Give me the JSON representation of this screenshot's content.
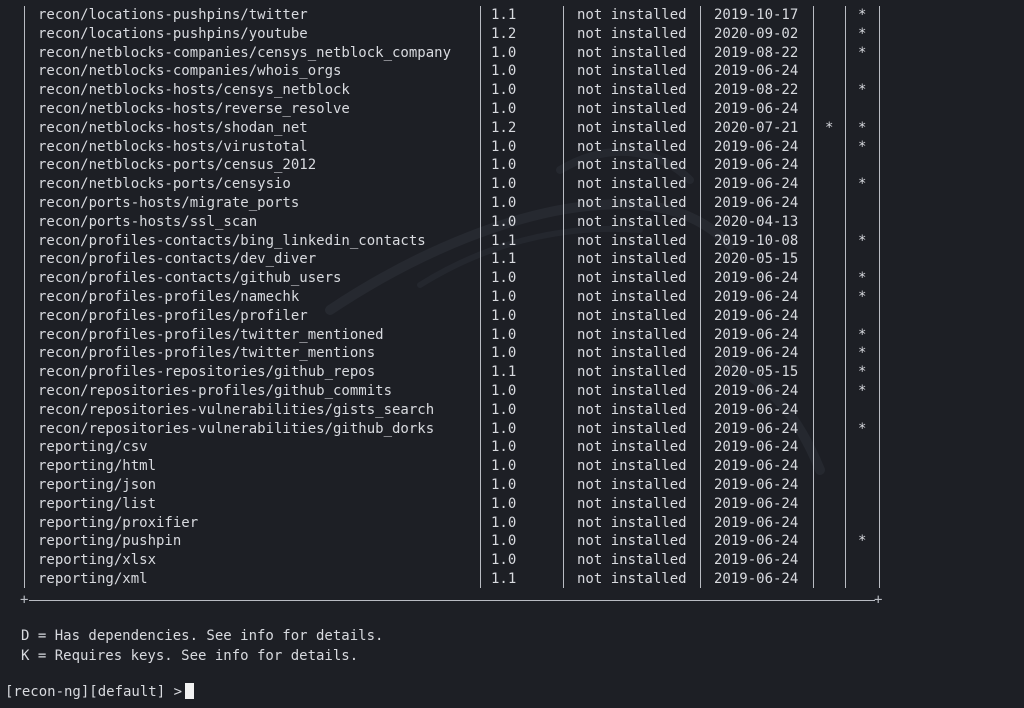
{
  "modules": [
    {
      "name": "recon/locations-pushpins/twitter",
      "version": "1.1",
      "status": "not installed",
      "updated": "2019-10-17",
      "d": "",
      "k": "*"
    },
    {
      "name": "recon/locations-pushpins/youtube",
      "version": "1.2",
      "status": "not installed",
      "updated": "2020-09-02",
      "d": "",
      "k": "*"
    },
    {
      "name": "recon/netblocks-companies/censys_netblock_company",
      "version": "1.0",
      "status": "not installed",
      "updated": "2019-08-22",
      "d": "",
      "k": "*"
    },
    {
      "name": "recon/netblocks-companies/whois_orgs",
      "version": "1.0",
      "status": "not installed",
      "updated": "2019-06-24",
      "d": "",
      "k": ""
    },
    {
      "name": "recon/netblocks-hosts/censys_netblock",
      "version": "1.0",
      "status": "not installed",
      "updated": "2019-08-22",
      "d": "",
      "k": "*"
    },
    {
      "name": "recon/netblocks-hosts/reverse_resolve",
      "version": "1.0",
      "status": "not installed",
      "updated": "2019-06-24",
      "d": "",
      "k": ""
    },
    {
      "name": "recon/netblocks-hosts/shodan_net",
      "version": "1.2",
      "status": "not installed",
      "updated": "2020-07-21",
      "d": "*",
      "k": "*"
    },
    {
      "name": "recon/netblocks-hosts/virustotal",
      "version": "1.0",
      "status": "not installed",
      "updated": "2019-06-24",
      "d": "",
      "k": "*"
    },
    {
      "name": "recon/netblocks-ports/census_2012",
      "version": "1.0",
      "status": "not installed",
      "updated": "2019-06-24",
      "d": "",
      "k": ""
    },
    {
      "name": "recon/netblocks-ports/censysio",
      "version": "1.0",
      "status": "not installed",
      "updated": "2019-06-24",
      "d": "",
      "k": "*"
    },
    {
      "name": "recon/ports-hosts/migrate_ports",
      "version": "1.0",
      "status": "not installed",
      "updated": "2019-06-24",
      "d": "",
      "k": ""
    },
    {
      "name": "recon/ports-hosts/ssl_scan",
      "version": "1.0",
      "status": "not installed",
      "updated": "2020-04-13",
      "d": "",
      "k": ""
    },
    {
      "name": "recon/profiles-contacts/bing_linkedin_contacts",
      "version": "1.1",
      "status": "not installed",
      "updated": "2019-10-08",
      "d": "",
      "k": "*"
    },
    {
      "name": "recon/profiles-contacts/dev_diver",
      "version": "1.1",
      "status": "not installed",
      "updated": "2020-05-15",
      "d": "",
      "k": ""
    },
    {
      "name": "recon/profiles-contacts/github_users",
      "version": "1.0",
      "status": "not installed",
      "updated": "2019-06-24",
      "d": "",
      "k": "*"
    },
    {
      "name": "recon/profiles-profiles/namechk",
      "version": "1.0",
      "status": "not installed",
      "updated": "2019-06-24",
      "d": "",
      "k": "*"
    },
    {
      "name": "recon/profiles-profiles/profiler",
      "version": "1.0",
      "status": "not installed",
      "updated": "2019-06-24",
      "d": "",
      "k": ""
    },
    {
      "name": "recon/profiles-profiles/twitter_mentioned",
      "version": "1.0",
      "status": "not installed",
      "updated": "2019-06-24",
      "d": "",
      "k": "*"
    },
    {
      "name": "recon/profiles-profiles/twitter_mentions",
      "version": "1.0",
      "status": "not installed",
      "updated": "2019-06-24",
      "d": "",
      "k": "*"
    },
    {
      "name": "recon/profiles-repositories/github_repos",
      "version": "1.1",
      "status": "not installed",
      "updated": "2020-05-15",
      "d": "",
      "k": "*"
    },
    {
      "name": "recon/repositories-profiles/github_commits",
      "version": "1.0",
      "status": "not installed",
      "updated": "2019-06-24",
      "d": "",
      "k": "*"
    },
    {
      "name": "recon/repositories-vulnerabilities/gists_search",
      "version": "1.0",
      "status": "not installed",
      "updated": "2019-06-24",
      "d": "",
      "k": ""
    },
    {
      "name": "recon/repositories-vulnerabilities/github_dorks",
      "version": "1.0",
      "status": "not installed",
      "updated": "2019-06-24",
      "d": "",
      "k": "*"
    },
    {
      "name": "reporting/csv",
      "version": "1.0",
      "status": "not installed",
      "updated": "2019-06-24",
      "d": "",
      "k": ""
    },
    {
      "name": "reporting/html",
      "version": "1.0",
      "status": "not installed",
      "updated": "2019-06-24",
      "d": "",
      "k": ""
    },
    {
      "name": "reporting/json",
      "version": "1.0",
      "status": "not installed",
      "updated": "2019-06-24",
      "d": "",
      "k": ""
    },
    {
      "name": "reporting/list",
      "version": "1.0",
      "status": "not installed",
      "updated": "2019-06-24",
      "d": "",
      "k": ""
    },
    {
      "name": "reporting/proxifier",
      "version": "1.0",
      "status": "not installed",
      "updated": "2019-06-24",
      "d": "",
      "k": ""
    },
    {
      "name": "reporting/pushpin",
      "version": "1.0",
      "status": "not installed",
      "updated": "2019-06-24",
      "d": "",
      "k": "*"
    },
    {
      "name": "reporting/xlsx",
      "version": "1.0",
      "status": "not installed",
      "updated": "2019-06-24",
      "d": "",
      "k": ""
    },
    {
      "name": "reporting/xml",
      "version": "1.1",
      "status": "not installed",
      "updated": "2019-06-24",
      "d": "",
      "k": ""
    }
  ],
  "legend": {
    "d_line": "D = Has dependencies. See info for details.",
    "k_line": "K = Requires keys. See info for details."
  },
  "prompt": {
    "text": "[recon-ng][default] >"
  },
  "colors": {
    "background": "#1d1f25",
    "text": "#d8dadf",
    "border": "#b9bcc3",
    "cursor": "#f2f2f2"
  }
}
